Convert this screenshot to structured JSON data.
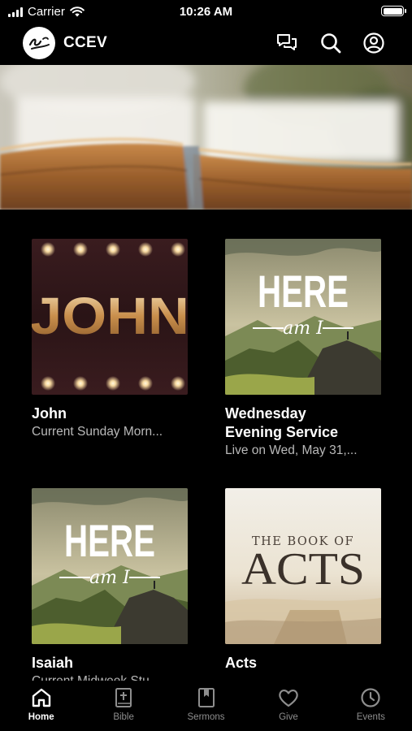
{
  "status_bar": {
    "carrier": "Carrier",
    "time": "10:26 AM"
  },
  "header": {
    "title": "CCEV",
    "logo_icon": "ccev-logo",
    "actions": [
      "chat-icon",
      "search-icon",
      "account-icon"
    ]
  },
  "cards": [
    {
      "art_text": "JOHN",
      "title": "John",
      "subtitle": "Current Sunday Morn..."
    },
    {
      "art_text": "HERE",
      "art_text2": "am I",
      "title": "Wednesday\nEvening Service",
      "subtitle": "Live on Wed, May 31,..."
    },
    {
      "art_text": "HERE",
      "art_text2": "am I",
      "title": "Isaiah",
      "subtitle": "Current Midweek Stu..."
    },
    {
      "art_text": "THE BOOK OF",
      "art_text2": "ACTS",
      "title": "Acts",
      "subtitle": ""
    }
  ],
  "tabs": [
    {
      "label": "Home",
      "icon": "home-icon",
      "active": true
    },
    {
      "label": "Bible",
      "icon": "bible-icon",
      "active": false
    },
    {
      "label": "Sermons",
      "icon": "bookmark-book-icon",
      "active": false
    },
    {
      "label": "Give",
      "icon": "heart-icon",
      "active": false
    },
    {
      "label": "Events",
      "icon": "clock-icon",
      "active": false
    }
  ]
}
